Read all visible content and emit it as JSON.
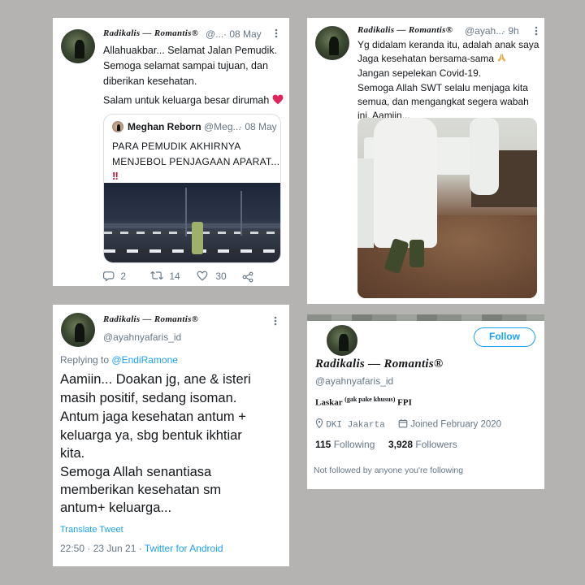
{
  "tweet1": {
    "display_name": "Radikalis — Romantis®",
    "handle": "@...",
    "date": "· 08 May",
    "lines": [
      "Allahuakbar... Selamat Jalan Pemudik.",
      "Semoga selamat sampai tujuan, dan",
      "diberikan kesehatan.",
      "Salam untuk keluarga besar dirumah"
    ],
    "quoted": {
      "display_name": "Meghan Reborn",
      "handle": "@Meg...",
      "date": "· 08 May",
      "lines": [
        "PARA PEMUDIK AKHIRNYA",
        "MENJEBOL PENJAGAAN APARAT..."
      ],
      "emoji": "‼"
    },
    "actions": {
      "replies": "2",
      "retweets": "14",
      "likes": "30"
    },
    "icons": [
      "reply-icon",
      "retweet-icon",
      "like-icon",
      "share-icon",
      "heart-emoji-icon",
      "more-icon"
    ]
  },
  "tweet2": {
    "display_name": "Radikalis — Romantis®",
    "handle": "@ayah...",
    "date": "· 9h",
    "lines": [
      "Yg didalam keranda itu, adalah anak saya",
      "Jaga kesehatan bersama-sama",
      "Jangan sepelekan Covid-19.",
      "Semoga Allah SWT selalu menjaga kita",
      "semua, dan mengangkat segera wabah",
      "ini. Aamiin..."
    ],
    "icons": [
      "praying-hands-icon",
      "more-icon"
    ]
  },
  "tweet3": {
    "display_name": "Radikalis — Romantis®",
    "handle": "@ayahnyafaris_id",
    "replying_prefix": "Replying to",
    "replying_to": "@EndiRamone",
    "lines": [
      "Aamiin... Doakan jg, ane & isteri",
      "masih positif, sedang isoman.",
      "Antum jaga kesehatan antum +",
      "keluarga ya, sbg bentuk ikhtiar",
      "kita.",
      "Semoga Allah senantiasa",
      "memberikan kesehatan sm",
      "antum+ keluarga..."
    ],
    "translate": "Translate Tweet",
    "timestamp": "22:50 · 23 Jun 21 ·",
    "source": "Twitter for Android"
  },
  "profile": {
    "follow_label": "Follow",
    "display_name": "Radikalis — Romantis®",
    "handle": "@ayahnyafaris_id",
    "bio_prefix": "Laskar",
    "bio_sup": "(gak pake khusus)",
    "bio_suffix": "FPI",
    "location": "DKI Jakarta",
    "joined": "Joined February 2020",
    "following_count": "115",
    "following_label": "Following",
    "followers_count": "3,928",
    "followers_label": "Followers",
    "not_followed": "Not followed by anyone you're following",
    "icons": [
      "location-pin-icon",
      "calendar-icon"
    ]
  },
  "colors": {
    "link": "#1da1f2",
    "secondary_text": "#657786",
    "heart": "#e0245e",
    "background": "#b4b3b1"
  }
}
